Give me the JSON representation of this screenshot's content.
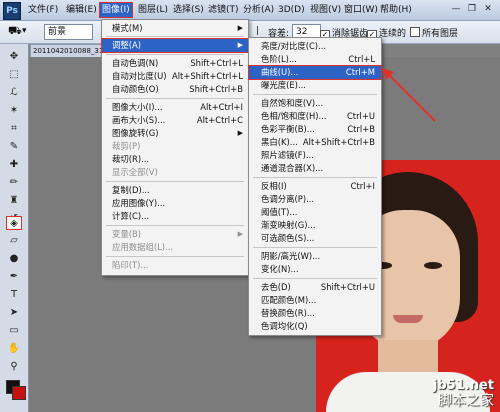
{
  "menubar": {
    "logo": "Ps",
    "items": [
      "文件(F)",
      "编辑(E)",
      "图像(I)",
      "图层(L)",
      "选择(S)",
      "滤镜(T)",
      "分析(A)",
      "3D(D)",
      "视图(V)",
      "窗口(W)",
      "帮助(H)"
    ]
  },
  "options": {
    "mode_value": "前景",
    "tolerance_label": "容差:",
    "tolerance_value": "32",
    "antialias": "消除锯齿",
    "contiguous": "连续的",
    "all_layers": "所有图层"
  },
  "document": {
    "tab_title": "2011042010088_3118"
  },
  "image_menu": {
    "items": [
      {
        "label": "模式(M)",
        "shortcut": "",
        "submenu": true
      },
      {
        "label": "调整(A)",
        "shortcut": "",
        "submenu": true,
        "highlight": true
      },
      {
        "label": "自动色调(N)",
        "shortcut": "Shift+Ctrl+L"
      },
      {
        "label": "自动对比度(U)",
        "shortcut": "Alt+Shift+Ctrl+L"
      },
      {
        "label": "自动颜色(O)",
        "shortcut": "Shift+Ctrl+B"
      },
      {
        "label": "图像大小(I)...",
        "shortcut": "Alt+Ctrl+I"
      },
      {
        "label": "画布大小(S)...",
        "shortcut": "Alt+Ctrl+C"
      },
      {
        "label": "图像旋转(G)",
        "shortcut": "",
        "submenu": true
      },
      {
        "label": "裁剪(P)",
        "shortcut": "",
        "disabled": true
      },
      {
        "label": "裁切(R)...",
        "shortcut": ""
      },
      {
        "label": "显示全部(V)",
        "shortcut": "",
        "disabled": true
      },
      {
        "label": "复制(D)...",
        "shortcut": ""
      },
      {
        "label": "应用图像(Y)...",
        "shortcut": ""
      },
      {
        "label": "计算(C)...",
        "shortcut": ""
      },
      {
        "label": "变量(B)",
        "shortcut": "",
        "submenu": true,
        "disabled": true
      },
      {
        "label": "应用数据组(L)...",
        "shortcut": "",
        "disabled": true
      },
      {
        "label": "陷印(T)...",
        "shortcut": "",
        "disabled": true
      }
    ]
  },
  "adjust_menu": {
    "items": [
      {
        "label": "亮度/对比度(C)...",
        "shortcut": ""
      },
      {
        "label": "色阶(L)...",
        "shortcut": "Ctrl+L"
      },
      {
        "label": "曲线(U)...",
        "shortcut": "Ctrl+M",
        "highlight": true
      },
      {
        "label": "曝光度(E)...",
        "shortcut": ""
      },
      {
        "label": "自然饱和度(V)...",
        "shortcut": ""
      },
      {
        "label": "色相/饱和度(H)...",
        "shortcut": "Ctrl+U"
      },
      {
        "label": "色彩平衡(B)...",
        "shortcut": "Ctrl+B"
      },
      {
        "label": "黑白(K)...",
        "shortcut": "Alt+Shift+Ctrl+B"
      },
      {
        "label": "照片滤镜(F)...",
        "shortcut": ""
      },
      {
        "label": "通道混合器(X)...",
        "shortcut": ""
      },
      {
        "label": "反相(I)",
        "shortcut": "Ctrl+I"
      },
      {
        "label": "色调分离(P)...",
        "shortcut": ""
      },
      {
        "label": "阈值(T)...",
        "shortcut": ""
      },
      {
        "label": "渐变映射(G)...",
        "shortcut": ""
      },
      {
        "label": "可选颜色(S)...",
        "shortcut": ""
      },
      {
        "label": "阴影/高光(W)...",
        "shortcut": ""
      },
      {
        "label": "变化(N)...",
        "shortcut": ""
      },
      {
        "label": "去色(D)",
        "shortcut": "Shift+Ctrl+U"
      },
      {
        "label": "匹配颜色(M)...",
        "shortcut": ""
      },
      {
        "label": "替换颜色(R)...",
        "shortcut": ""
      },
      {
        "label": "色调均化(Q)",
        "shortcut": ""
      }
    ]
  },
  "watermark": {
    "line1": "jb51.net",
    "line2": "脚本之家"
  },
  "colors": {
    "accent": "#2c63c5",
    "highlight_border": "#e0302a",
    "photo_bg": "#d6231e"
  }
}
